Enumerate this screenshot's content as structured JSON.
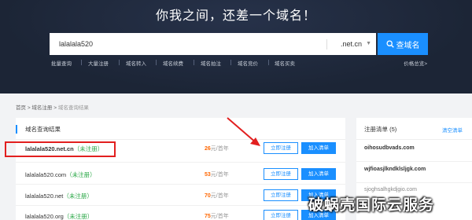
{
  "hero": {
    "title": "你我之间，还差一个域名！"
  },
  "search": {
    "value": "lalalala520",
    "tld": ".net.cn",
    "button_label": "查域名"
  },
  "nav": {
    "items": [
      "批量查询",
      "大量注册",
      "域名转入",
      "域名续费",
      "域名拍注",
      "域名竞价",
      "域名买卖"
    ],
    "price_link": "价格总览>"
  },
  "breadcrumb": {
    "home": "首页",
    "sep": ">",
    "domain_reg": "域名注册",
    "current": "域名查询结果"
  },
  "results": {
    "title": "域名查询结果",
    "register_label": "立即注册",
    "cart_label": "加入清单",
    "rows": [
      {
        "name": "lalalala520.net.cn",
        "status": "（未注册）",
        "price": "26",
        "unit": "元/首年"
      },
      {
        "name": "lalalala520.com",
        "status": "（未注册）",
        "price": "53",
        "unit": "元/首年"
      },
      {
        "name": "lalalala520.net",
        "status": "（未注册）",
        "price": "70",
        "unit": "元/首年"
      },
      {
        "name": "lalalala520.org",
        "status": "（未注册）",
        "price": "75",
        "unit": "元/首年"
      }
    ]
  },
  "registration_list": {
    "title": "注册清单 (5)",
    "clear_label": "清空清单",
    "items": [
      "oihosudbvads.com",
      "wjfioasjlkndklsljgk.com",
      "sjoghsalhgkdjgio.com"
    ]
  },
  "watermark": "破蜗壳国际云服务",
  "colors": {
    "accent": "#1a8fff",
    "price": "#ff6600",
    "available": "#28a745",
    "highlight": "#e21f1f",
    "hero_bg": "#1c2536"
  }
}
